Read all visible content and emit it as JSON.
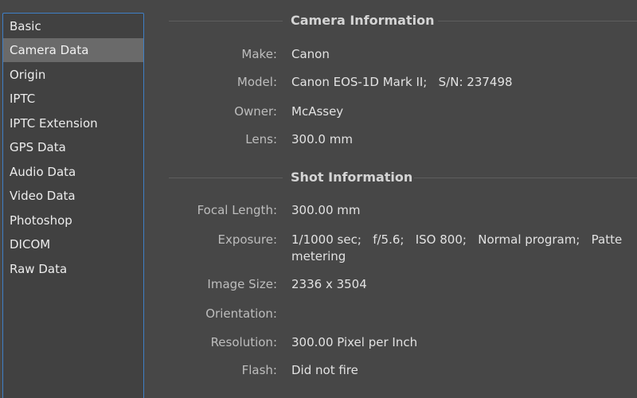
{
  "sidebar": {
    "items": [
      {
        "label": "Basic"
      },
      {
        "label": "Camera Data"
      },
      {
        "label": "Origin"
      },
      {
        "label": "IPTC"
      },
      {
        "label": "IPTC Extension"
      },
      {
        "label": "GPS Data"
      },
      {
        "label": "Audio Data"
      },
      {
        "label": "Video Data"
      },
      {
        "label": "Photoshop"
      },
      {
        "label": "DICOM"
      },
      {
        "label": "Raw Data"
      }
    ],
    "selected_label": "Camera Data"
  },
  "camera_info": {
    "title": "Camera Information",
    "rows": [
      {
        "label": "Make:",
        "value": "Canon"
      },
      {
        "label": "Model:",
        "value": "Canon EOS-1D Mark II;   S/N: 237498"
      },
      {
        "label": "Owner:",
        "value": "McAssey"
      },
      {
        "label": "Lens:",
        "value": "300.0 mm"
      }
    ]
  },
  "shot_info": {
    "title": "Shot Information",
    "rows": [
      {
        "label": "Focal Length:",
        "value": "300.00 mm"
      },
      {
        "label": "Exposure:",
        "value": "1/1000 sec;   f/5.6;   ISO 800;   Normal program;   Patte",
        "value2": "metering"
      },
      {
        "label": "Image Size:",
        "value": "2336 x 3504"
      },
      {
        "label": "Orientation:",
        "value": ""
      },
      {
        "label": "Resolution:",
        "value": "300.00 Pixel per Inch"
      },
      {
        "label": "Flash:",
        "value": "Did not fire"
      }
    ]
  },
  "colors": {
    "background": "#474747",
    "sidebar_border": "#3f7fc6",
    "selected_item": "#6a6a6a"
  }
}
